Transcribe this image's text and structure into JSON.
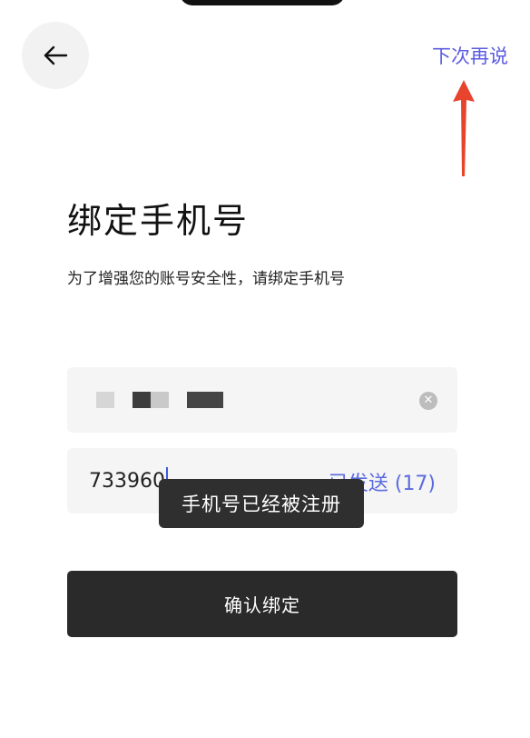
{
  "header": {
    "back_icon": "arrow-left-icon",
    "skip_label": "下次再说"
  },
  "annotation": {
    "arrow_icon": "red-up-arrow-icon",
    "arrow_color": "#e8432d"
  },
  "main": {
    "title": "绑定手机号",
    "subtitle": "为了增强您的账号安全性，请绑定手机号"
  },
  "phone_field": {
    "value_masked": true,
    "clear_icon": "clear-circle-icon"
  },
  "code_field": {
    "value": "733960",
    "resend_status": "已发送 (17)"
  },
  "toast": {
    "message": "手机号已经被注册"
  },
  "actions": {
    "confirm_label": "确认绑定"
  },
  "colors": {
    "accent": "#5b5ce2",
    "button_bg": "#2a2a2a",
    "field_bg": "#f5f5f5",
    "toast_bg": "#2f2f2f"
  }
}
